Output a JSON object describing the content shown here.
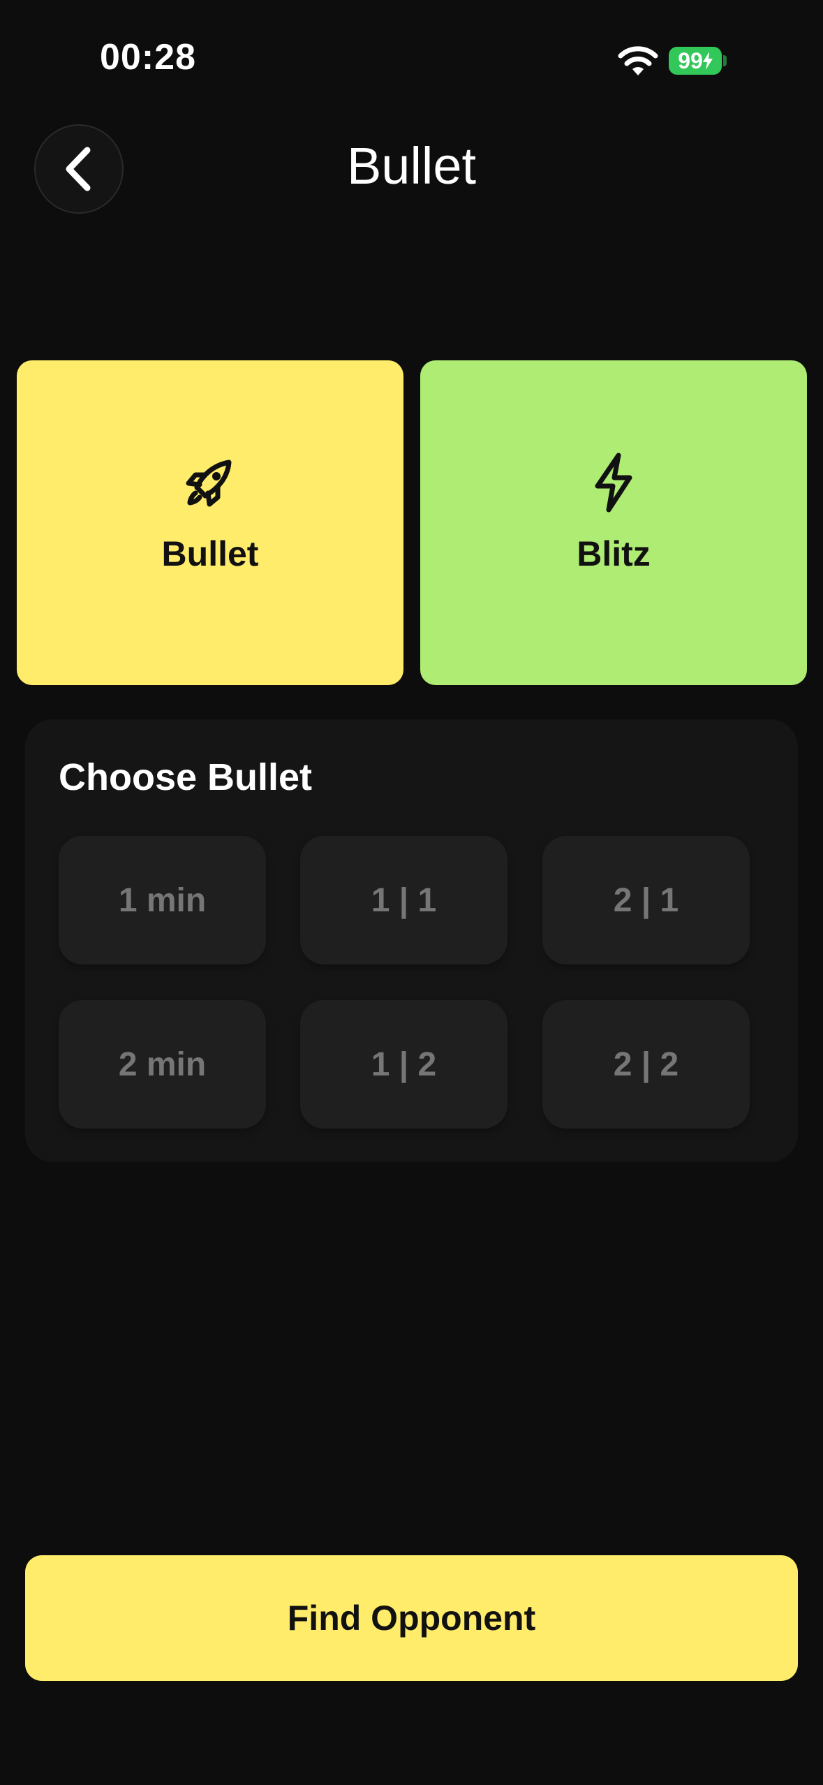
{
  "status_bar": {
    "time": "00:28",
    "battery": "99",
    "battery_color": "#32c759"
  },
  "header": {
    "title": "Bullet",
    "back_icon": "chevron-left-icon"
  },
  "modes": [
    {
      "label": "Bullet",
      "icon": "rocket-icon",
      "color": "#ffec6b"
    },
    {
      "label": "Blitz",
      "icon": "lightning-icon",
      "color": "#aeec74"
    }
  ],
  "choose": {
    "title": "Choose Bullet",
    "options": [
      "1 min",
      "1 | 1",
      "2 | 1",
      "2 min",
      "1 | 2",
      "2 | 2"
    ]
  },
  "find_button": {
    "label": "Find Opponent",
    "color": "#ffec6b"
  }
}
